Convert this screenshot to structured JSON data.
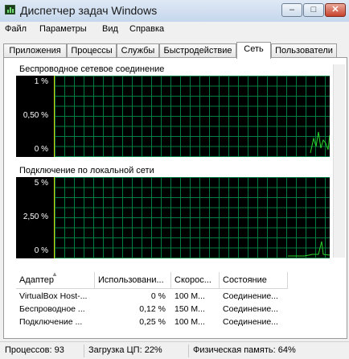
{
  "window": {
    "title": "Диспетчер задач Windows",
    "app_icon": "task-manager-icon",
    "buttons": {
      "minimize": "–",
      "maximize": "□",
      "close": "✕"
    }
  },
  "menu": [
    "Файл",
    "Параметры",
    "Вид",
    "Справка"
  ],
  "tabs": [
    "Приложения",
    "Процессы",
    "Службы",
    "Быстродействие",
    "Сеть",
    "Пользователи"
  ],
  "active_tab": "Сеть",
  "graphs": [
    {
      "title": "Беспроводное сетевое соединение",
      "y_labels": [
        "1 %",
        "0,50 %",
        "0 %"
      ],
      "max": 1
    },
    {
      "title": "Подключение по локальной сети",
      "y_labels": [
        "5 %",
        "2,50 %",
        "0 %"
      ],
      "max": 5
    }
  ],
  "table": {
    "columns": [
      "Адаптер",
      "Использовани...",
      "Скорос...",
      "Состояние"
    ],
    "rows": [
      [
        "VirtualBox Host-...",
        "0 %",
        "100 М...",
        "Соединение..."
      ],
      [
        "Беспроводное ...",
        "0,12 %",
        "150 М...",
        "Соединение..."
      ],
      [
        "Подключение ...",
        "0,25 %",
        "100 М...",
        "Соединение..."
      ]
    ]
  },
  "status": {
    "processes": "Процессов: 93",
    "cpu": "Загрузка ЦП: 22%",
    "memory": "Физическая память: 64%"
  },
  "colors": {
    "graph_bg": "#000000",
    "grid": "#008040",
    "line": "#2cd62c",
    "axis": "#d6d600"
  }
}
